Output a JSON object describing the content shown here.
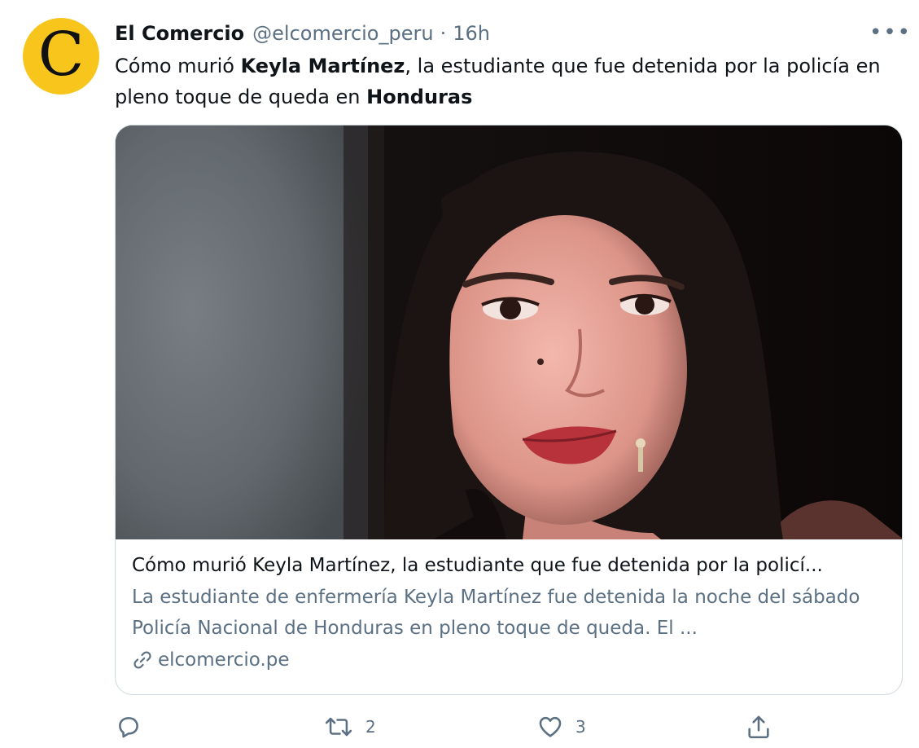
{
  "tweet": {
    "author_name": "El Comercio",
    "handle": "@elcomercio_peru",
    "separator": "·",
    "time": "16h",
    "more_label": "•••",
    "avatar_letter": "C",
    "avatar_color": "#f7c51b",
    "text": {
      "part1": "Cómo murió ",
      "bold1": "Keyla Martínez",
      "part2": ", la estudiante que fue detenida por la policía en pleno toque de queda en ",
      "bold2": "Honduras"
    }
  },
  "card": {
    "image_icon": "portrait-photo",
    "title": "Cómo murió Keyla Martínez, la estudiante que fue detenida por la policí...",
    "description": "La estudiante de enfermería Keyla Martínez fue detenida la noche del sábado Policía Nacional de Honduras en pleno toque de queda. El ...",
    "domain": "elcomercio.pe",
    "domain_icon": "link-icon"
  },
  "actions": {
    "reply_icon": "reply-icon",
    "reply_count": "",
    "retweet_icon": "retweet-icon",
    "retweet_count": "2",
    "like_icon": "heart-icon",
    "like_count": "3",
    "share_icon": "share-icon"
  },
  "colors": {
    "text_primary": "#0f1419",
    "text_secondary": "#5b7083",
    "border": "#cfd9de"
  }
}
